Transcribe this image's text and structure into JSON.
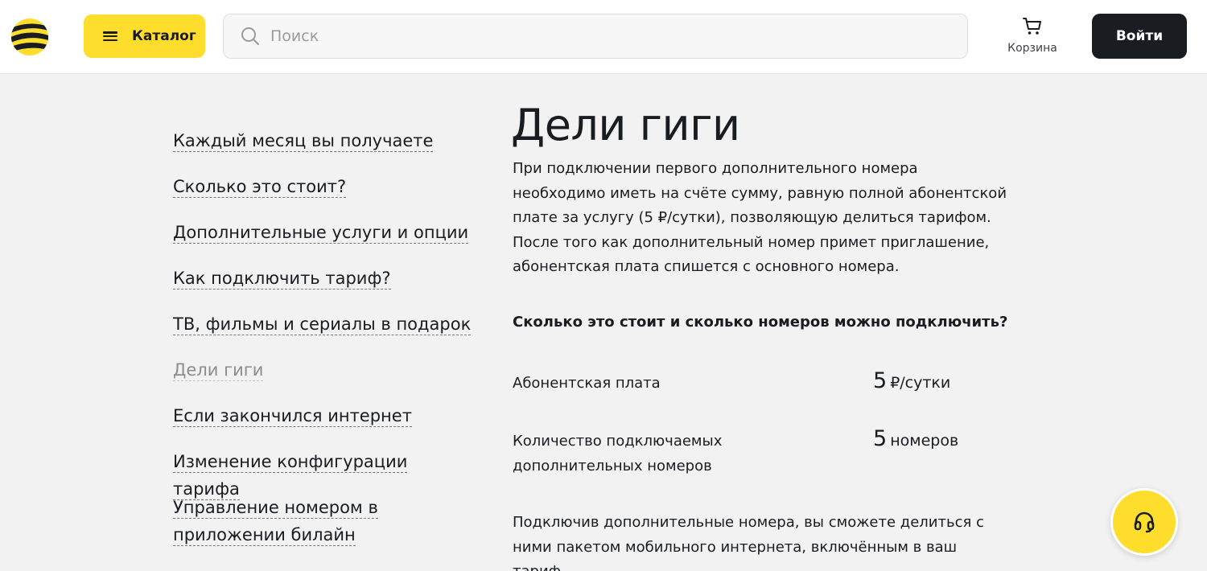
{
  "header": {
    "logo_icon": "beeline-logo-icon",
    "catalog_label": "Каталог",
    "search_placeholder": "Поиск",
    "cart_label": "Корзина",
    "login_label": "Войти"
  },
  "colors": {
    "brand_yellow": "#ffdd2d",
    "dark": "#191c20",
    "background": "#f2f2f2"
  },
  "sidebar": {
    "items": [
      {
        "label": "Каждый месяц вы получаете",
        "active": false
      },
      {
        "label": "Сколько это стоит?",
        "active": false
      },
      {
        "label": "Дополнительные услуги и опции",
        "active": false
      },
      {
        "label": "Как подключить тариф?",
        "active": false
      },
      {
        "label": "ТВ, фильмы и сериалы в подарок",
        "active": false
      },
      {
        "label": "Дели гиги",
        "active": true
      },
      {
        "label": "Если закончился интернет",
        "active": false
      },
      {
        "label": "Изменение конфигурации тарифа",
        "active": false
      },
      {
        "label": "Управление номером в приложении билайн",
        "active": false
      }
    ]
  },
  "main": {
    "title": "Дели гиги",
    "intro": "При подключении первого дополнительного номера необходимо иметь на счёте сумму, равную полной абонентской плате за услугу (5 ₽/сутки), позволяющую делиться тарифом. После того как дополнительный номер примет приглашение, абонентская плата спишется с основного номера.",
    "sub_heading": "Сколько это стоит и сколько номеров можно подключить?",
    "rows": [
      {
        "label": "Абонентская плата",
        "value": "5",
        "unit": "₽/сутки"
      },
      {
        "label": "Количество подключаемых дополнительных номеров",
        "value": "5",
        "unit": "номеров"
      }
    ],
    "outro": "Подключив дополнительные номера, вы сможете делиться с ними пакетом мобильного интернета, включённым в ваш тариф."
  },
  "help": {
    "icon": "headset-icon"
  }
}
